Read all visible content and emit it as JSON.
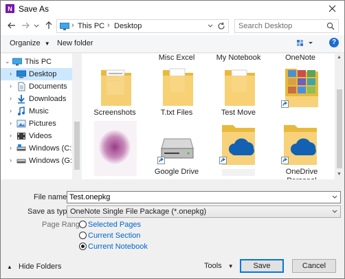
{
  "window": {
    "title": "Save As",
    "app_icon": "onenote-icon"
  },
  "address": {
    "crumbs": [
      "This PC",
      "Desktop"
    ],
    "search_placeholder": "Search Desktop"
  },
  "toolbar": {
    "organize_label": "Organize",
    "new_folder_label": "New folder",
    "help_label": "?"
  },
  "nav_items": [
    {
      "label": "This PC",
      "icon": "pc-icon"
    },
    {
      "label": "Desktop",
      "icon": "desktop-icon"
    },
    {
      "label": "Documents",
      "icon": "documents-icon"
    },
    {
      "label": "Downloads",
      "icon": "downloads-icon"
    },
    {
      "label": "Music",
      "icon": "music-icon"
    },
    {
      "label": "Pictures",
      "icon": "pictures-icon"
    },
    {
      "label": "Videos",
      "icon": "videos-icon"
    },
    {
      "label": "Windows (C:)",
      "icon": "drive-icon"
    },
    {
      "label": "Windows (G:)",
      "icon": "drive-icon"
    }
  ],
  "files": [
    {
      "label": "Misc Excel"
    },
    {
      "label": "My Notebook"
    },
    {
      "label": "OneNote"
    },
    {
      "label": "Screenshots"
    },
    {
      "label": "T.txt Files"
    },
    {
      "label": "Test Move"
    },
    {
      "label": "Google Drive"
    },
    {
      "label": "OneDrive Personal"
    }
  ],
  "form": {
    "filename_label": "File name:",
    "filename_value": "Test.onepkg",
    "savetype_label": "Save as type:",
    "savetype_value": "OneNote Single File Package (*.onepkg)",
    "page_range_label": "Page Range:",
    "range_options": [
      "Selected Pages",
      "Current Section",
      "Current Notebook"
    ],
    "range_selected": "Current Notebook"
  },
  "footer": {
    "hide_folders_label": "Hide Folders",
    "tools_label": "Tools",
    "save_label": "Save",
    "cancel_label": "Cancel"
  },
  "colors": {
    "selection": "#cce8ff",
    "accent": "#0078d7",
    "link": "#0066cc",
    "folder": "#f5c850"
  }
}
